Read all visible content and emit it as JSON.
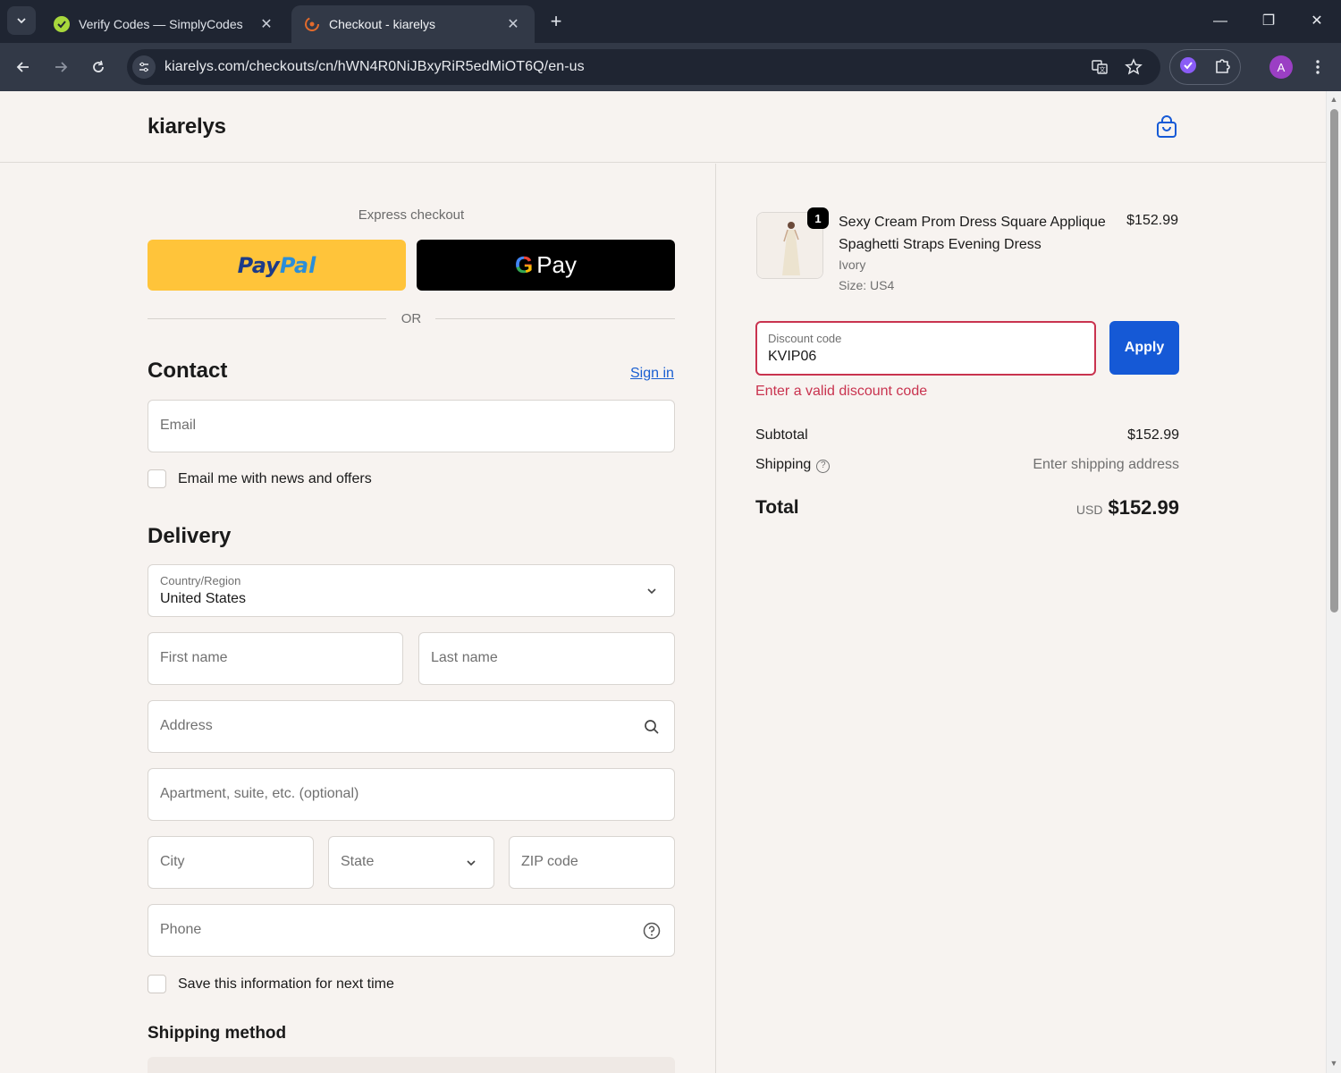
{
  "browser": {
    "tabs": [
      {
        "title": "Verify Codes — SimplyCodes",
        "close": "✕"
      },
      {
        "title": "Checkout - kiarelys",
        "close": "✕"
      }
    ],
    "new_tab": "+",
    "url": "kiarelys.com/checkouts/cn/hWN4R0NiJBxyRiR5edMiOT6Q/en-us",
    "avatar_letter": "A",
    "window_controls": {
      "minimize": "—",
      "restore": "❐",
      "close": "✕"
    }
  },
  "store": {
    "name": "kiarelys"
  },
  "checkout": {
    "express_label": "Express checkout",
    "paypal": {
      "part1": "Pay",
      "part2": "Pal"
    },
    "gpay": {
      "g": "G",
      "label": "Pay"
    },
    "or": "OR",
    "contact_heading": "Contact",
    "sign_in": "Sign in",
    "email_placeholder": "Email",
    "email_news_label": "Email me with news and offers",
    "delivery_heading": "Delivery",
    "country_label": "Country/Region",
    "country_value": "United States",
    "first_name": "First name",
    "last_name": "Last name",
    "address": "Address",
    "apartment": "Apartment, suite, etc. (optional)",
    "city": "City",
    "state": "State",
    "zip": "ZIP code",
    "phone": "Phone",
    "save_info_label": "Save this information for next time",
    "shipping_method_heading": "Shipping method"
  },
  "summary": {
    "item": {
      "quantity": "1",
      "name": "Sexy Cream Prom Dress Square Applique Spaghetti Straps Evening Dress",
      "color": "Ivory",
      "size": "Size: US4",
      "price": "$152.99"
    },
    "discount_label": "Discount code",
    "discount_value": "KVIP06",
    "apply_label": "Apply",
    "error": "Enter a valid discount code",
    "subtotal_label": "Subtotal",
    "subtotal_value": "$152.99",
    "shipping_label": "Shipping",
    "shipping_value": "Enter shipping address",
    "total_label": "Total",
    "currency": "USD",
    "total_value": "$152.99"
  },
  "colors": {
    "accent": "#1559d6",
    "error": "#c9334f",
    "paypal_yellow": "#ffc43a",
    "page_bg": "#f7f3f0"
  }
}
